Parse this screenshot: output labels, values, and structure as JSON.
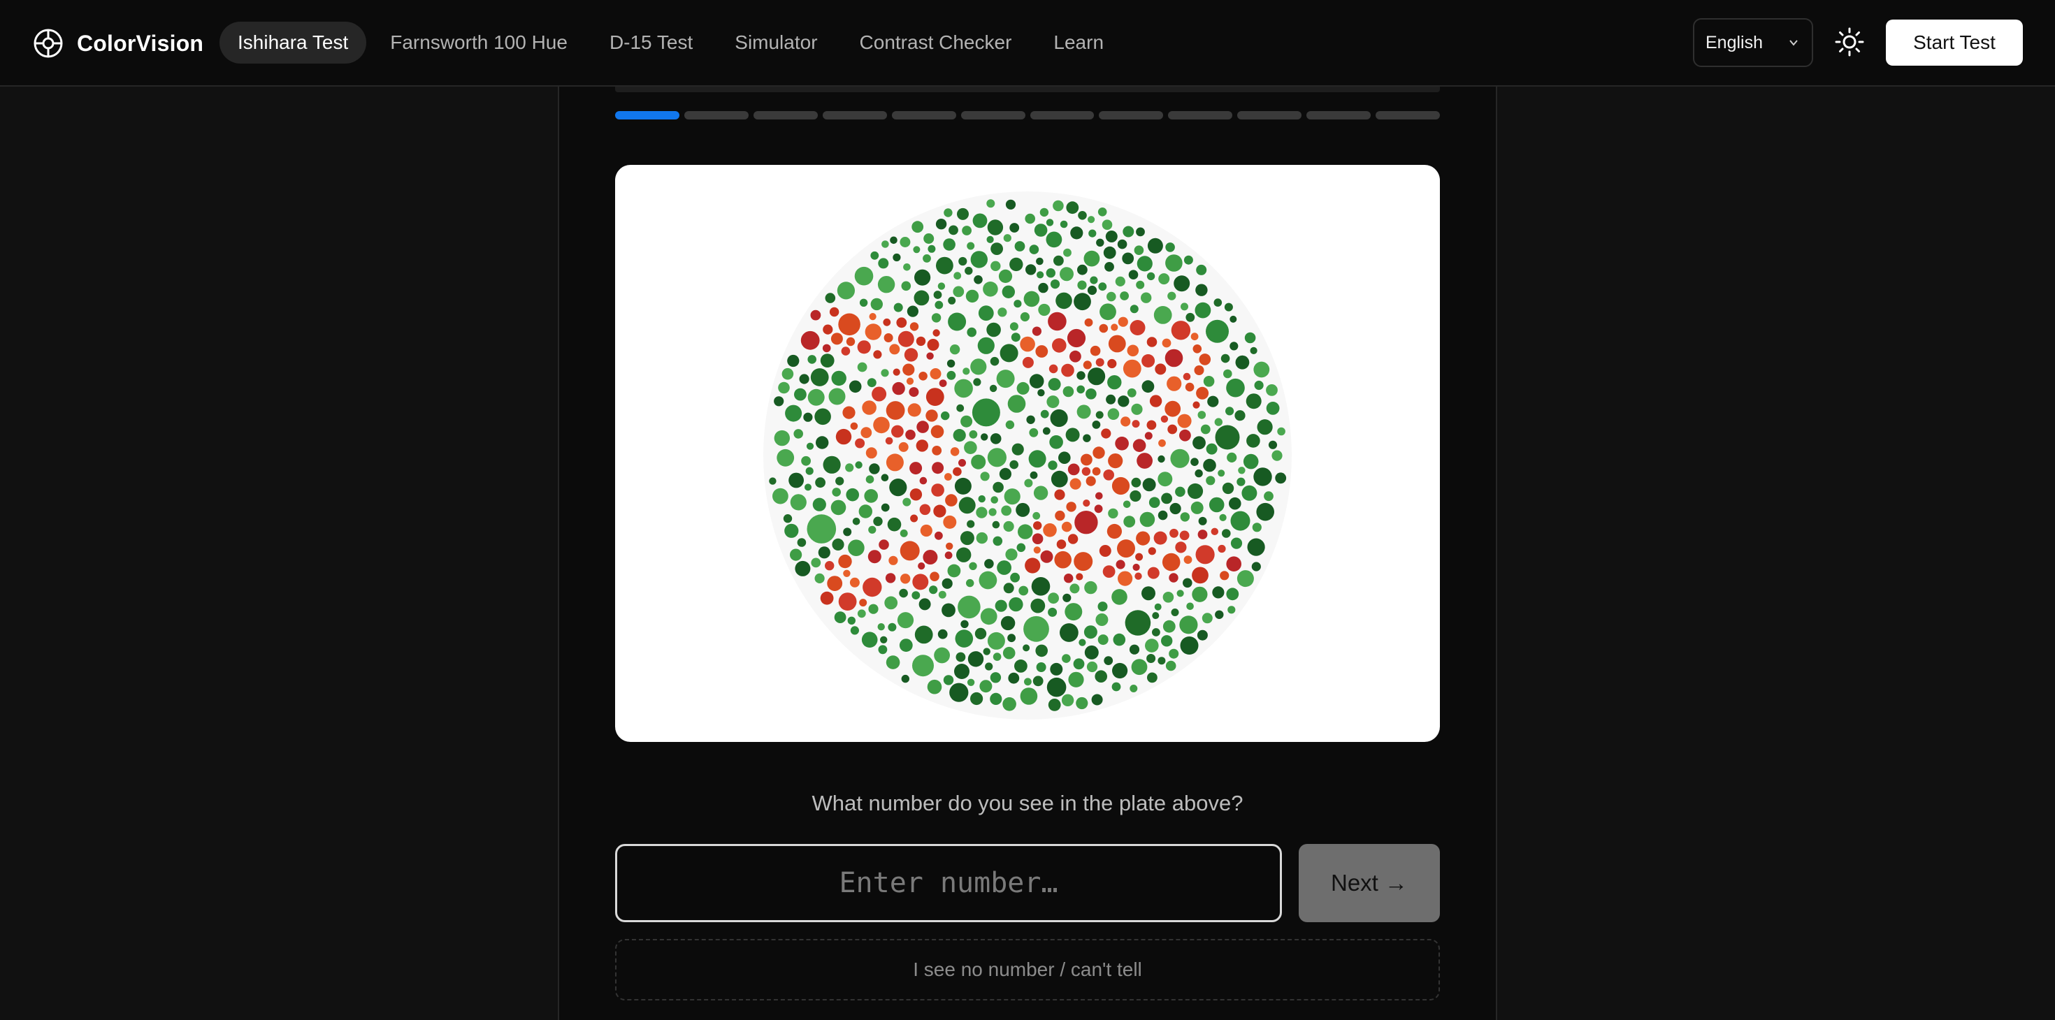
{
  "header": {
    "brand": "ColorVision",
    "logo_icon": "aperture-logo-icon",
    "nav": [
      {
        "label": "Ishihara Test",
        "active": true
      },
      {
        "label": "Farnsworth 100 Hue",
        "active": false
      },
      {
        "label": "D-15 Test",
        "active": false
      },
      {
        "label": "Simulator",
        "active": false
      },
      {
        "label": "Contrast Checker",
        "active": false
      },
      {
        "label": "Learn",
        "active": false
      }
    ],
    "language": "English",
    "theme_icon": "sun-icon",
    "start_label": "Start Test"
  },
  "test": {
    "progress": {
      "current": 1,
      "total": 12,
      "accent": "#1177ee"
    },
    "plate_icon": "ishihara-plate",
    "question": "What number do you see in the plate above?",
    "input_placeholder": "Enter number…",
    "input_value": "",
    "next_label": "Next →",
    "no_number_label": "I see no number / can't tell"
  },
  "colors": {
    "background": "#111111",
    "panel": "#0b0b0b",
    "accent": "#1177ee",
    "plate_greens": [
      "#2e8b3a",
      "#1f6b28",
      "#3f9d45",
      "#4aa84f",
      "#175a22"
    ],
    "plate_reds": [
      "#d94a1f",
      "#c8321e",
      "#e8602a",
      "#b92628",
      "#d13a2a"
    ]
  }
}
